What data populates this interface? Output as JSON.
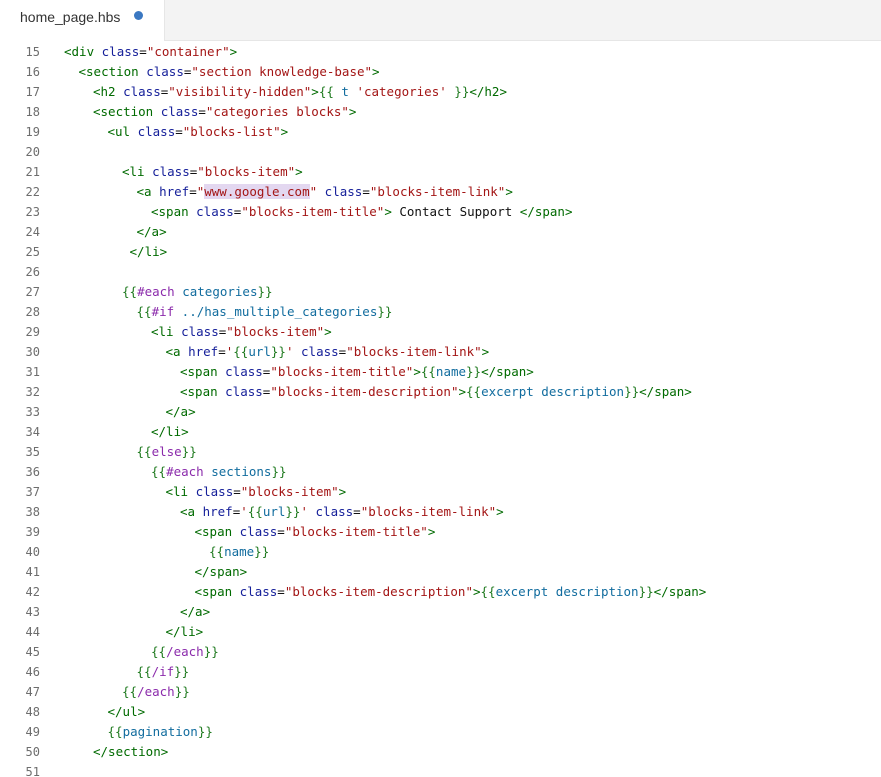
{
  "tab": {
    "filename": "home_page.hbs",
    "modified_indicator_color": "#3b78c2"
  },
  "colors": {
    "tag": "#006a00",
    "attr": "#16209a",
    "string": "#a31515",
    "handlebars": "#1f7a1f",
    "keyword": "#8b2bab",
    "variable": "#116c9e",
    "selection": "#e3d7f0"
  },
  "lines": [
    {
      "n": "15",
      "indent": 0,
      "tokens": [
        {
          "t": "<div ",
          "c": "tag"
        },
        {
          "t": "class",
          "c": "attr"
        },
        {
          "t": "=",
          "c": "txt"
        },
        {
          "t": "\"container\"",
          "c": "str"
        },
        {
          "t": ">",
          "c": "tag"
        }
      ]
    },
    {
      "n": "16",
      "indent": 1,
      "tokens": [
        {
          "t": "<section ",
          "c": "tag"
        },
        {
          "t": "class",
          "c": "attr"
        },
        {
          "t": "=",
          "c": "txt"
        },
        {
          "t": "\"section knowledge-base\"",
          "c": "str"
        },
        {
          "t": ">",
          "c": "tag"
        }
      ]
    },
    {
      "n": "17",
      "indent": 2,
      "tokens": [
        {
          "t": "<h2 ",
          "c": "tag"
        },
        {
          "t": "class",
          "c": "attr"
        },
        {
          "t": "=",
          "c": "txt"
        },
        {
          "t": "\"visibility-hidden\"",
          "c": "str"
        },
        {
          "t": ">",
          "c": "tag"
        },
        {
          "t": "{{ ",
          "c": "hb"
        },
        {
          "t": "t ",
          "c": "var"
        },
        {
          "t": "'categories'",
          "c": "str"
        },
        {
          "t": " }}",
          "c": "hb"
        },
        {
          "t": "</h2>",
          "c": "tag"
        }
      ]
    },
    {
      "n": "18",
      "indent": 2,
      "tokens": [
        {
          "t": "<section ",
          "c": "tag"
        },
        {
          "t": "class",
          "c": "attr"
        },
        {
          "t": "=",
          "c": "txt"
        },
        {
          "t": "\"categories blocks\"",
          "c": "str"
        },
        {
          "t": ">",
          "c": "tag"
        }
      ]
    },
    {
      "n": "19",
      "indent": 3,
      "tokens": [
        {
          "t": "<ul ",
          "c": "tag"
        },
        {
          "t": "class",
          "c": "attr"
        },
        {
          "t": "=",
          "c": "txt"
        },
        {
          "t": "\"blocks-list\"",
          "c": "str"
        },
        {
          "t": ">",
          "c": "tag"
        }
      ]
    },
    {
      "n": "20",
      "indent": 0,
      "tokens": []
    },
    {
      "n": "21",
      "indent": 4,
      "tokens": [
        {
          "t": "<li ",
          "c": "tag"
        },
        {
          "t": "class",
          "c": "attr"
        },
        {
          "t": "=",
          "c": "txt"
        },
        {
          "t": "\"blocks-item\"",
          "c": "str"
        },
        {
          "t": ">",
          "c": "tag"
        }
      ]
    },
    {
      "n": "22",
      "indent": 5,
      "tokens": [
        {
          "t": "<a ",
          "c": "tag"
        },
        {
          "t": "href",
          "c": "attr"
        },
        {
          "t": "=",
          "c": "txt"
        },
        {
          "t": "\"",
          "c": "str"
        },
        {
          "t": "www.google.com",
          "c": "str",
          "hl": true
        },
        {
          "t": "\"",
          "c": "str"
        },
        {
          "t": " ",
          "c": "txt"
        },
        {
          "t": "class",
          "c": "attr"
        },
        {
          "t": "=",
          "c": "txt"
        },
        {
          "t": "\"blocks-item-link\"",
          "c": "str"
        },
        {
          "t": ">",
          "c": "tag"
        }
      ]
    },
    {
      "n": "23",
      "indent": 6,
      "tokens": [
        {
          "t": "<span ",
          "c": "tag"
        },
        {
          "t": "class",
          "c": "attr"
        },
        {
          "t": "=",
          "c": "txt"
        },
        {
          "t": "\"blocks-item-title\"",
          "c": "str"
        },
        {
          "t": ">",
          "c": "tag"
        },
        {
          "t": " Contact Support ",
          "c": "txt"
        },
        {
          "t": "</span>",
          "c": "tag"
        }
      ]
    },
    {
      "n": "24",
      "indent": 5,
      "tokens": [
        {
          "t": "</a>",
          "c": "tag"
        }
      ]
    },
    {
      "n": "25",
      "indent": 4,
      "tokens": [
        {
          "t": " </li>",
          "c": "tag"
        }
      ]
    },
    {
      "n": "26",
      "indent": 0,
      "tokens": []
    },
    {
      "n": "27",
      "indent": 4,
      "tokens": [
        {
          "t": "{{",
          "c": "hb"
        },
        {
          "t": "#each ",
          "c": "kw"
        },
        {
          "t": "categories",
          "c": "var"
        },
        {
          "t": "}}",
          "c": "hb"
        }
      ]
    },
    {
      "n": "28",
      "indent": 5,
      "tokens": [
        {
          "t": "{{",
          "c": "hb"
        },
        {
          "t": "#if ",
          "c": "kw"
        },
        {
          "t": "../has_multiple_categories",
          "c": "var"
        },
        {
          "t": "}}",
          "c": "hb"
        }
      ]
    },
    {
      "n": "29",
      "indent": 6,
      "tokens": [
        {
          "t": "<li ",
          "c": "tag"
        },
        {
          "t": "class",
          "c": "attr"
        },
        {
          "t": "=",
          "c": "txt"
        },
        {
          "t": "\"blocks-item\"",
          "c": "str"
        },
        {
          "t": ">",
          "c": "tag"
        }
      ]
    },
    {
      "n": "30",
      "indent": 7,
      "tokens": [
        {
          "t": "<a ",
          "c": "tag"
        },
        {
          "t": "href",
          "c": "attr"
        },
        {
          "t": "=",
          "c": "txt"
        },
        {
          "t": "'",
          "c": "str"
        },
        {
          "t": "{{",
          "c": "hb"
        },
        {
          "t": "url",
          "c": "var"
        },
        {
          "t": "}}",
          "c": "hb"
        },
        {
          "t": "'",
          "c": "str"
        },
        {
          "t": " ",
          "c": "txt"
        },
        {
          "t": "class",
          "c": "attr"
        },
        {
          "t": "=",
          "c": "txt"
        },
        {
          "t": "\"blocks-item-link\"",
          "c": "str"
        },
        {
          "t": ">",
          "c": "tag"
        }
      ]
    },
    {
      "n": "31",
      "indent": 8,
      "tokens": [
        {
          "t": "<span ",
          "c": "tag"
        },
        {
          "t": "class",
          "c": "attr"
        },
        {
          "t": "=",
          "c": "txt"
        },
        {
          "t": "\"blocks-item-title\"",
          "c": "str"
        },
        {
          "t": ">",
          "c": "tag"
        },
        {
          "t": "{{",
          "c": "hb"
        },
        {
          "t": "name",
          "c": "var"
        },
        {
          "t": "}}",
          "c": "hb"
        },
        {
          "t": "</span>",
          "c": "tag"
        }
      ]
    },
    {
      "n": "32",
      "indent": 8,
      "tokens": [
        {
          "t": "<span ",
          "c": "tag"
        },
        {
          "t": "class",
          "c": "attr"
        },
        {
          "t": "=",
          "c": "txt"
        },
        {
          "t": "\"blocks-item-description\"",
          "c": "str"
        },
        {
          "t": ">",
          "c": "tag"
        },
        {
          "t": "{{",
          "c": "hb"
        },
        {
          "t": "excerpt ",
          "c": "var"
        },
        {
          "t": "description",
          "c": "var"
        },
        {
          "t": "}}",
          "c": "hb"
        },
        {
          "t": "</span>",
          "c": "tag"
        }
      ]
    },
    {
      "n": "33",
      "indent": 7,
      "tokens": [
        {
          "t": "</a>",
          "c": "tag"
        }
      ]
    },
    {
      "n": "34",
      "indent": 6,
      "tokens": [
        {
          "t": "</li>",
          "c": "tag"
        }
      ]
    },
    {
      "n": "35",
      "indent": 5,
      "tokens": [
        {
          "t": "{{",
          "c": "hb"
        },
        {
          "t": "else",
          "c": "kw"
        },
        {
          "t": "}}",
          "c": "hb"
        }
      ]
    },
    {
      "n": "36",
      "indent": 6,
      "tokens": [
        {
          "t": "{{",
          "c": "hb"
        },
        {
          "t": "#each ",
          "c": "kw"
        },
        {
          "t": "sections",
          "c": "var"
        },
        {
          "t": "}}",
          "c": "hb"
        }
      ]
    },
    {
      "n": "37",
      "indent": 7,
      "tokens": [
        {
          "t": "<li ",
          "c": "tag"
        },
        {
          "t": "class",
          "c": "attr"
        },
        {
          "t": "=",
          "c": "txt"
        },
        {
          "t": "\"blocks-item\"",
          "c": "str"
        },
        {
          "t": ">",
          "c": "tag"
        }
      ]
    },
    {
      "n": "38",
      "indent": 8,
      "tokens": [
        {
          "t": "<a ",
          "c": "tag"
        },
        {
          "t": "href",
          "c": "attr"
        },
        {
          "t": "=",
          "c": "txt"
        },
        {
          "t": "'",
          "c": "str"
        },
        {
          "t": "{{",
          "c": "hb"
        },
        {
          "t": "url",
          "c": "var"
        },
        {
          "t": "}}",
          "c": "hb"
        },
        {
          "t": "'",
          "c": "str"
        },
        {
          "t": " ",
          "c": "txt"
        },
        {
          "t": "class",
          "c": "attr"
        },
        {
          "t": "=",
          "c": "txt"
        },
        {
          "t": "\"blocks-item-link\"",
          "c": "str"
        },
        {
          "t": ">",
          "c": "tag"
        }
      ]
    },
    {
      "n": "39",
      "indent": 9,
      "tokens": [
        {
          "t": "<span ",
          "c": "tag"
        },
        {
          "t": "class",
          "c": "attr"
        },
        {
          "t": "=",
          "c": "txt"
        },
        {
          "t": "\"blocks-item-title\"",
          "c": "str"
        },
        {
          "t": ">",
          "c": "tag"
        }
      ]
    },
    {
      "n": "40",
      "indent": 10,
      "tokens": [
        {
          "t": "{{",
          "c": "hb"
        },
        {
          "t": "name",
          "c": "var"
        },
        {
          "t": "}}",
          "c": "hb"
        }
      ]
    },
    {
      "n": "41",
      "indent": 9,
      "tokens": [
        {
          "t": "</span>",
          "c": "tag"
        }
      ]
    },
    {
      "n": "42",
      "indent": 9,
      "tokens": [
        {
          "t": "<span ",
          "c": "tag"
        },
        {
          "t": "class",
          "c": "attr"
        },
        {
          "t": "=",
          "c": "txt"
        },
        {
          "t": "\"blocks-item-description\"",
          "c": "str"
        },
        {
          "t": ">",
          "c": "tag"
        },
        {
          "t": "{{",
          "c": "hb"
        },
        {
          "t": "excerpt ",
          "c": "var"
        },
        {
          "t": "description",
          "c": "var"
        },
        {
          "t": "}}",
          "c": "hb"
        },
        {
          "t": "</span>",
          "c": "tag"
        }
      ]
    },
    {
      "n": "43",
      "indent": 8,
      "tokens": [
        {
          "t": "</a>",
          "c": "tag"
        }
      ]
    },
    {
      "n": "44",
      "indent": 7,
      "tokens": [
        {
          "t": "</li>",
          "c": "tag"
        }
      ]
    },
    {
      "n": "45",
      "indent": 6,
      "tokens": [
        {
          "t": "{{",
          "c": "hb"
        },
        {
          "t": "/each",
          "c": "kw"
        },
        {
          "t": "}}",
          "c": "hb"
        }
      ]
    },
    {
      "n": "46",
      "indent": 5,
      "tokens": [
        {
          "t": "{{",
          "c": "hb"
        },
        {
          "t": "/if",
          "c": "kw"
        },
        {
          "t": "}}",
          "c": "hb"
        }
      ]
    },
    {
      "n": "47",
      "indent": 4,
      "tokens": [
        {
          "t": "{{",
          "c": "hb"
        },
        {
          "t": "/each",
          "c": "kw"
        },
        {
          "t": "}}",
          "c": "hb"
        }
      ]
    },
    {
      "n": "48",
      "indent": 3,
      "tokens": [
        {
          "t": "</ul>",
          "c": "tag"
        }
      ]
    },
    {
      "n": "49",
      "indent": 3,
      "tokens": [
        {
          "t": "{{",
          "c": "hb"
        },
        {
          "t": "pagination",
          "c": "var"
        },
        {
          "t": "}}",
          "c": "hb"
        }
      ]
    },
    {
      "n": "50",
      "indent": 2,
      "tokens": [
        {
          "t": "</section>",
          "c": "tag"
        }
      ]
    },
    {
      "n": "51",
      "indent": 0,
      "tokens": []
    }
  ]
}
